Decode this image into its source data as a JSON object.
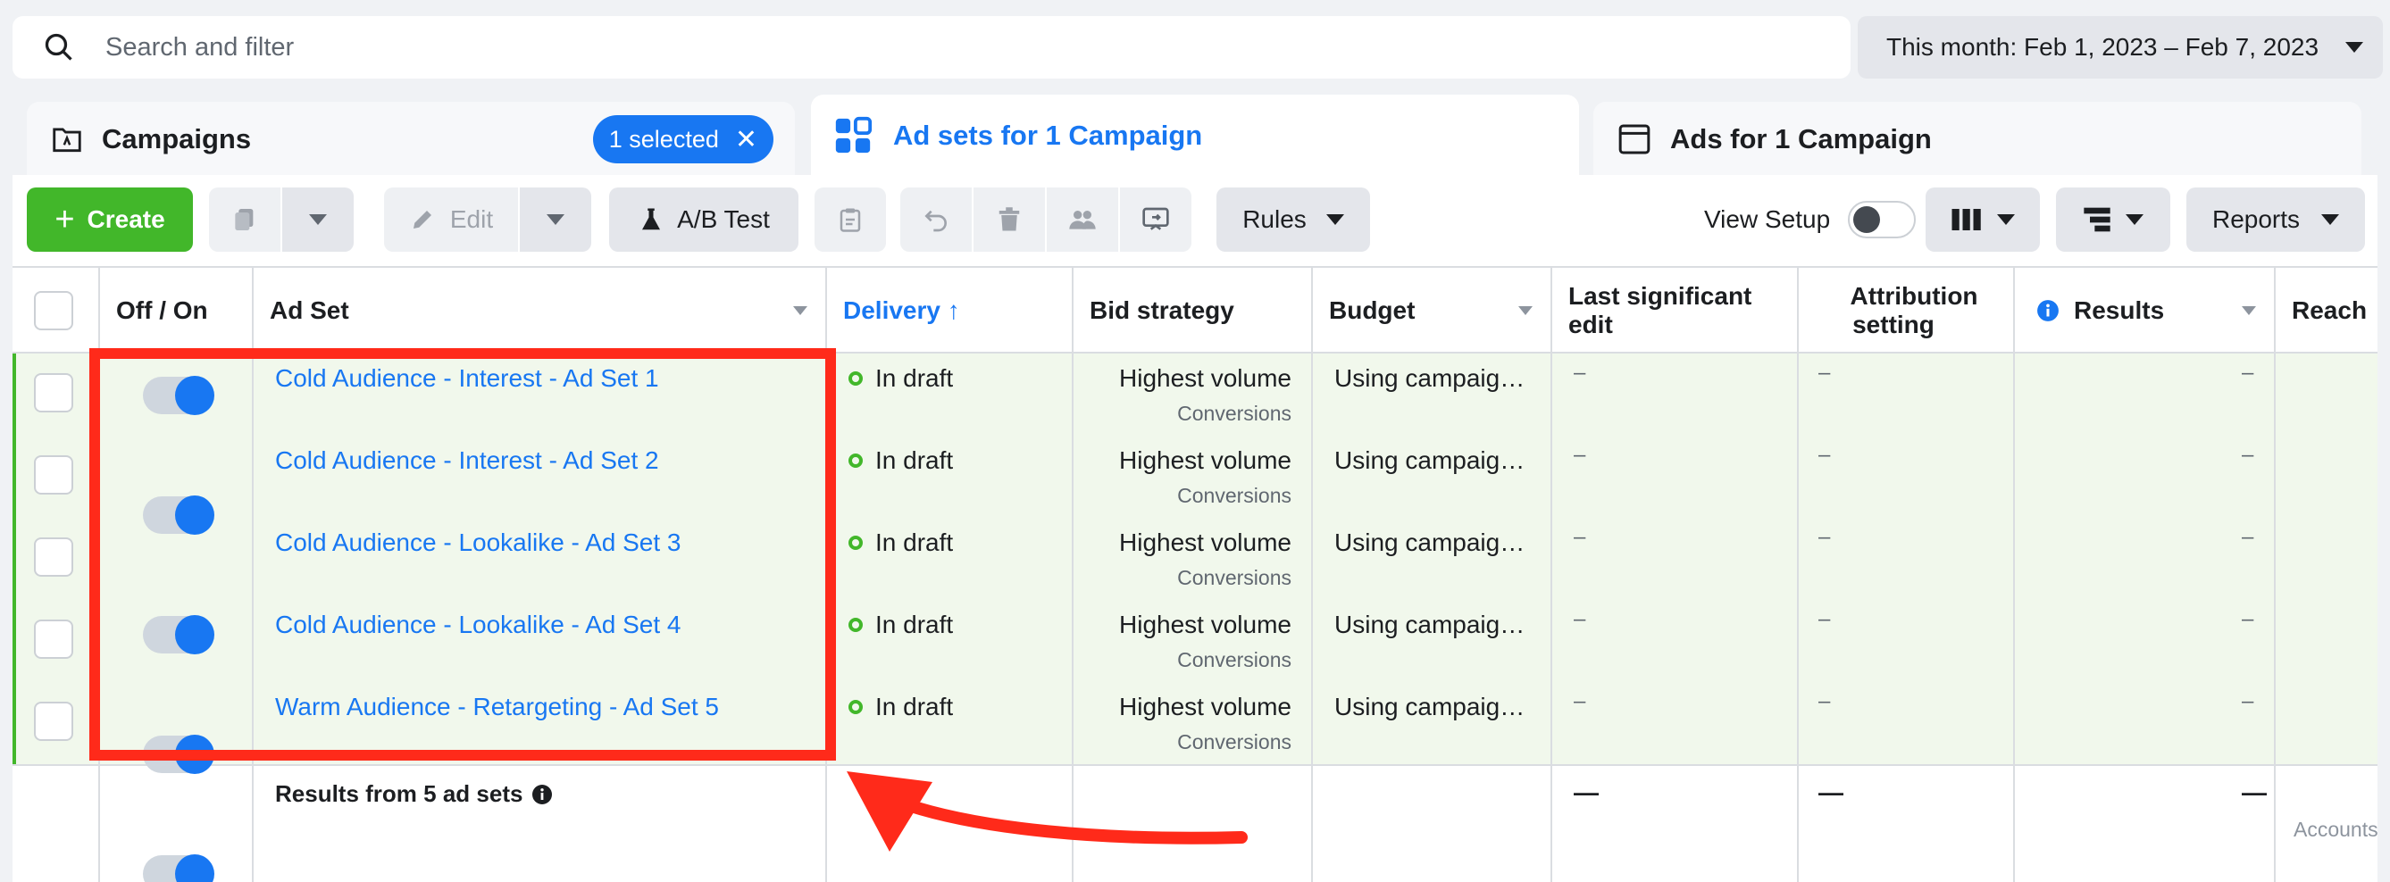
{
  "search": {
    "placeholder": "Search and filter"
  },
  "date_range": {
    "label": "This month: Feb 1, 2023 – Feb 7, 2023"
  },
  "tabs": {
    "campaigns": {
      "label": "Campaigns",
      "selected_badge": "1 selected"
    },
    "ad_sets": {
      "label": "Ad sets for 1 Campaign"
    },
    "ads": {
      "label": "Ads for 1 Campaign"
    }
  },
  "toolbar": {
    "create": "Create",
    "edit": "Edit",
    "ab_test": "A/B Test",
    "rules": "Rules",
    "view_setup": "View Setup",
    "reports": "Reports"
  },
  "columns": {
    "off_on": "Off / On",
    "ad_set": "Ad Set",
    "delivery": "Delivery ↑",
    "bid_strategy": "Bid strategy",
    "budget": "Budget",
    "last_edit_1": "Last significant",
    "last_edit_2": "edit",
    "attribution_1": "Attribution",
    "attribution_2": "setting",
    "results": "Results",
    "reach": "Reach"
  },
  "rows": [
    {
      "name": "Cold Audience - Interest - Ad Set 1",
      "delivery": "In draft",
      "bid": "Highest volume",
      "bid_sub": "Conversions",
      "budget": "Using campaig…",
      "last_edit": "–",
      "attribution": "–",
      "results": "–"
    },
    {
      "name": "Cold Audience - Interest - Ad Set 2",
      "delivery": "In draft",
      "bid": "Highest volume",
      "bid_sub": "Conversions",
      "budget": "Using campaig…",
      "last_edit": "–",
      "attribution": "–",
      "results": "–"
    },
    {
      "name": "Cold Audience - Lookalike - Ad Set 3",
      "delivery": "In draft",
      "bid": "Highest volume",
      "bid_sub": "Conversions",
      "budget": "Using campaig…",
      "last_edit": "–",
      "attribution": "–",
      "results": "–"
    },
    {
      "name": "Cold Audience - Lookalike - Ad Set 4",
      "delivery": "In draft",
      "bid": "Highest volume",
      "bid_sub": "Conversions",
      "budget": "Using campaig…",
      "last_edit": "–",
      "attribution": "–",
      "results": "–"
    },
    {
      "name": "Warm Audience - Retargeting - Ad Set 5",
      "delivery": "In draft",
      "bid": "Highest volume",
      "bid_sub": "Conversions",
      "budget": "Using campaig…",
      "last_edit": "–",
      "attribution": "–",
      "results": "–"
    }
  ],
  "summary": {
    "label": "Results from 5 ad sets",
    "last_edit": "—",
    "attribution": "—",
    "results": "—",
    "reach": "Accounts"
  },
  "colors": {
    "accent": "#1877f2",
    "create": "#42b72a",
    "highlight": "#ff2a1a",
    "row_bg": "#f1f8ec"
  }
}
